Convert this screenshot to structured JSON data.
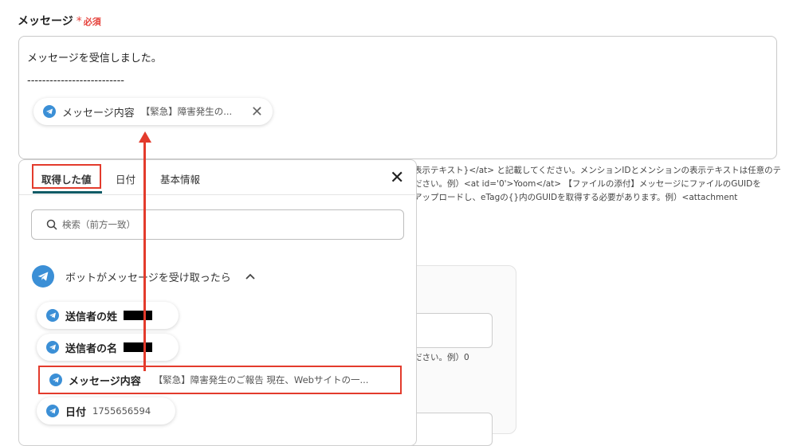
{
  "field": {
    "label": "メッセージ",
    "required_mark": "*",
    "required_text": "必須"
  },
  "message": {
    "line1": "メッセージを受信しました。",
    "line2": "--------------------------",
    "chip_key": "メッセージ内容",
    "chip_value": "【緊急】障害発生の...",
    "chip_close": "✕"
  },
  "help_text": {
    "line1": "表示テキスト}</at> と記載してください。メンションIDとメンションの表示テキストは任意のテ",
    "line2": "ださい。例）<at id='0'>Yoom</at> 【ファイルの添付】メッセージにファイルのGUIDを",
    "line3": "アップロードし、eTagの{}内のGUIDを取得する必要があります。例）<attachment",
    "line4": "ださい。例）0"
  },
  "popup": {
    "tabs": [
      "取得した値",
      "日付",
      "基本情報"
    ],
    "close": "✕",
    "search_placeholder": "検索（前方一致）",
    "section_title": "ボットがメッセージを受け取ったら",
    "chevron": "^",
    "options": [
      {
        "key": "送信者の姓",
        "value": ""
      },
      {
        "key": "送信者の名",
        "value": ""
      },
      {
        "key": "メッセージ内容",
        "value": "【緊急】障害発生のご報告 現在、Webサイトの一..."
      },
      {
        "key": "日付",
        "value": "1755656594"
      }
    ]
  },
  "colors": {
    "telegram": "#3b8fd6",
    "annotation_red": "#e33b2c",
    "tab_underline": "#0e5b66"
  }
}
